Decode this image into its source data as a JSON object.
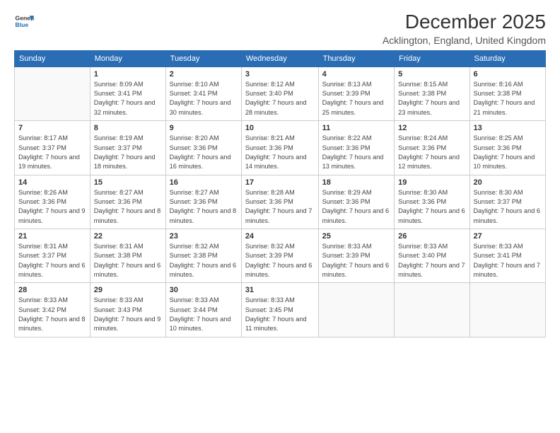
{
  "header": {
    "logo_general": "General",
    "logo_blue": "Blue",
    "month_title": "December 2025",
    "location": "Acklington, England, United Kingdom"
  },
  "days_of_week": [
    "Sunday",
    "Monday",
    "Tuesday",
    "Wednesday",
    "Thursday",
    "Friday",
    "Saturday"
  ],
  "weeks": [
    [
      {
        "num": "",
        "sunrise": "",
        "sunset": "",
        "daylight": "",
        "empty": true
      },
      {
        "num": "1",
        "sunrise": "Sunrise: 8:09 AM",
        "sunset": "Sunset: 3:41 PM",
        "daylight": "Daylight: 7 hours and 32 minutes."
      },
      {
        "num": "2",
        "sunrise": "Sunrise: 8:10 AM",
        "sunset": "Sunset: 3:41 PM",
        "daylight": "Daylight: 7 hours and 30 minutes."
      },
      {
        "num": "3",
        "sunrise": "Sunrise: 8:12 AM",
        "sunset": "Sunset: 3:40 PM",
        "daylight": "Daylight: 7 hours and 28 minutes."
      },
      {
        "num": "4",
        "sunrise": "Sunrise: 8:13 AM",
        "sunset": "Sunset: 3:39 PM",
        "daylight": "Daylight: 7 hours and 25 minutes."
      },
      {
        "num": "5",
        "sunrise": "Sunrise: 8:15 AM",
        "sunset": "Sunset: 3:38 PM",
        "daylight": "Daylight: 7 hours and 23 minutes."
      },
      {
        "num": "6",
        "sunrise": "Sunrise: 8:16 AM",
        "sunset": "Sunset: 3:38 PM",
        "daylight": "Daylight: 7 hours and 21 minutes."
      }
    ],
    [
      {
        "num": "7",
        "sunrise": "Sunrise: 8:17 AM",
        "sunset": "Sunset: 3:37 PM",
        "daylight": "Daylight: 7 hours and 19 minutes."
      },
      {
        "num": "8",
        "sunrise": "Sunrise: 8:19 AM",
        "sunset": "Sunset: 3:37 PM",
        "daylight": "Daylight: 7 hours and 18 minutes."
      },
      {
        "num": "9",
        "sunrise": "Sunrise: 8:20 AM",
        "sunset": "Sunset: 3:36 PM",
        "daylight": "Daylight: 7 hours and 16 minutes."
      },
      {
        "num": "10",
        "sunrise": "Sunrise: 8:21 AM",
        "sunset": "Sunset: 3:36 PM",
        "daylight": "Daylight: 7 hours and 14 minutes."
      },
      {
        "num": "11",
        "sunrise": "Sunrise: 8:22 AM",
        "sunset": "Sunset: 3:36 PM",
        "daylight": "Daylight: 7 hours and 13 minutes."
      },
      {
        "num": "12",
        "sunrise": "Sunrise: 8:24 AM",
        "sunset": "Sunset: 3:36 PM",
        "daylight": "Daylight: 7 hours and 12 minutes."
      },
      {
        "num": "13",
        "sunrise": "Sunrise: 8:25 AM",
        "sunset": "Sunset: 3:36 PM",
        "daylight": "Daylight: 7 hours and 10 minutes."
      }
    ],
    [
      {
        "num": "14",
        "sunrise": "Sunrise: 8:26 AM",
        "sunset": "Sunset: 3:36 PM",
        "daylight": "Daylight: 7 hours and 9 minutes."
      },
      {
        "num": "15",
        "sunrise": "Sunrise: 8:27 AM",
        "sunset": "Sunset: 3:36 PM",
        "daylight": "Daylight: 7 hours and 8 minutes."
      },
      {
        "num": "16",
        "sunrise": "Sunrise: 8:27 AM",
        "sunset": "Sunset: 3:36 PM",
        "daylight": "Daylight: 7 hours and 8 minutes."
      },
      {
        "num": "17",
        "sunrise": "Sunrise: 8:28 AM",
        "sunset": "Sunset: 3:36 PM",
        "daylight": "Daylight: 7 hours and 7 minutes."
      },
      {
        "num": "18",
        "sunrise": "Sunrise: 8:29 AM",
        "sunset": "Sunset: 3:36 PM",
        "daylight": "Daylight: 7 hours and 6 minutes."
      },
      {
        "num": "19",
        "sunrise": "Sunrise: 8:30 AM",
        "sunset": "Sunset: 3:36 PM",
        "daylight": "Daylight: 7 hours and 6 minutes."
      },
      {
        "num": "20",
        "sunrise": "Sunrise: 8:30 AM",
        "sunset": "Sunset: 3:37 PM",
        "daylight": "Daylight: 7 hours and 6 minutes."
      }
    ],
    [
      {
        "num": "21",
        "sunrise": "Sunrise: 8:31 AM",
        "sunset": "Sunset: 3:37 PM",
        "daylight": "Daylight: 7 hours and 6 minutes."
      },
      {
        "num": "22",
        "sunrise": "Sunrise: 8:31 AM",
        "sunset": "Sunset: 3:38 PM",
        "daylight": "Daylight: 7 hours and 6 minutes."
      },
      {
        "num": "23",
        "sunrise": "Sunrise: 8:32 AM",
        "sunset": "Sunset: 3:38 PM",
        "daylight": "Daylight: 7 hours and 6 minutes."
      },
      {
        "num": "24",
        "sunrise": "Sunrise: 8:32 AM",
        "sunset": "Sunset: 3:39 PM",
        "daylight": "Daylight: 7 hours and 6 minutes."
      },
      {
        "num": "25",
        "sunrise": "Sunrise: 8:33 AM",
        "sunset": "Sunset: 3:39 PM",
        "daylight": "Daylight: 7 hours and 6 minutes."
      },
      {
        "num": "26",
        "sunrise": "Sunrise: 8:33 AM",
        "sunset": "Sunset: 3:40 PM",
        "daylight": "Daylight: 7 hours and 7 minutes."
      },
      {
        "num": "27",
        "sunrise": "Sunrise: 8:33 AM",
        "sunset": "Sunset: 3:41 PM",
        "daylight": "Daylight: 7 hours and 7 minutes."
      }
    ],
    [
      {
        "num": "28",
        "sunrise": "Sunrise: 8:33 AM",
        "sunset": "Sunset: 3:42 PM",
        "daylight": "Daylight: 7 hours and 8 minutes."
      },
      {
        "num": "29",
        "sunrise": "Sunrise: 8:33 AM",
        "sunset": "Sunset: 3:43 PM",
        "daylight": "Daylight: 7 hours and 9 minutes."
      },
      {
        "num": "30",
        "sunrise": "Sunrise: 8:33 AM",
        "sunset": "Sunset: 3:44 PM",
        "daylight": "Daylight: 7 hours and 10 minutes."
      },
      {
        "num": "31",
        "sunrise": "Sunrise: 8:33 AM",
        "sunset": "Sunset: 3:45 PM",
        "daylight": "Daylight: 7 hours and 11 minutes."
      },
      {
        "num": "",
        "empty": true
      },
      {
        "num": "",
        "empty": true
      },
      {
        "num": "",
        "empty": true
      }
    ]
  ]
}
